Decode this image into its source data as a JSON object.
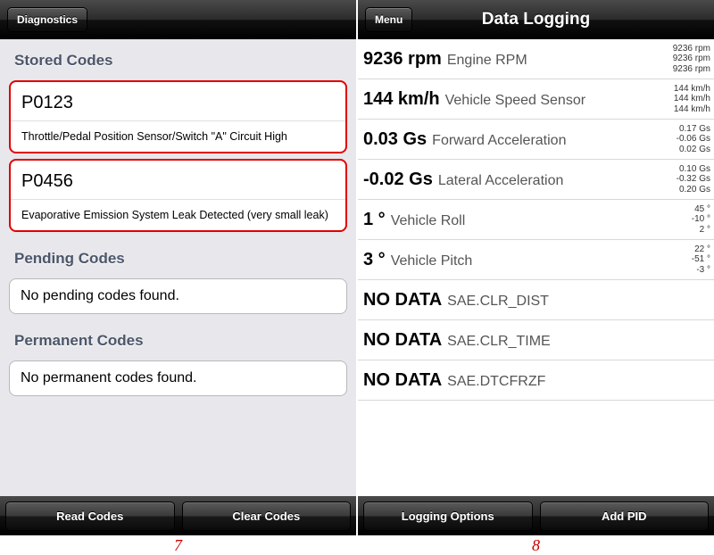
{
  "left": {
    "nav_back": "Diagnostics",
    "sections": {
      "stored": {
        "header": "Stored Codes",
        "codes": [
          {
            "code": "P0123",
            "desc": "Throttle/Pedal Position Sensor/Switch \"A\" Circuit High"
          },
          {
            "code": "P0456",
            "desc": "Evaporative Emission System Leak Detected (very small leak)"
          }
        ]
      },
      "pending": {
        "header": "Pending Codes",
        "empty": "No pending codes found."
      },
      "permanent": {
        "header": "Permanent Codes",
        "empty": "No permanent codes found."
      }
    },
    "toolbar": {
      "read": "Read Codes",
      "clear": "Clear Codes"
    },
    "caption": "7"
  },
  "right": {
    "nav_back": "Menu",
    "title": "Data Logging",
    "rows": [
      {
        "value": "9236 rpm",
        "label": "Engine RPM",
        "history": [
          "9236 rpm",
          "9236 rpm",
          "9236 rpm"
        ]
      },
      {
        "value": "144 km/h",
        "label": "Vehicle Speed Sensor",
        "history": [
          "144 km/h",
          "144 km/h",
          "144 km/h"
        ]
      },
      {
        "value": "0.03 Gs",
        "label": "Forward Acceleration",
        "history": [
          "0.17 Gs",
          "-0.06 Gs",
          "0.02 Gs"
        ]
      },
      {
        "value": "-0.02 Gs",
        "label": "Lateral Acceleration",
        "history": [
          "0.10 Gs",
          "-0.32 Gs",
          "0.20 Gs"
        ]
      },
      {
        "value": "1 °",
        "label": "Vehicle Roll",
        "history": [
          "45 °",
          "-10 °",
          "2 °"
        ]
      },
      {
        "value": "3 °",
        "label": "Vehicle Pitch",
        "history": [
          "22 °",
          "-51 °",
          "-3 °"
        ]
      },
      {
        "value": "NO DATA",
        "label": "SAE.CLR_DIST",
        "history": []
      },
      {
        "value": "NO DATA",
        "label": "SAE.CLR_TIME",
        "history": []
      },
      {
        "value": "NO DATA",
        "label": "SAE.DTCFRZF",
        "history": []
      }
    ],
    "toolbar": {
      "options": "Logging Options",
      "add": "Add PID"
    },
    "caption": "8"
  }
}
